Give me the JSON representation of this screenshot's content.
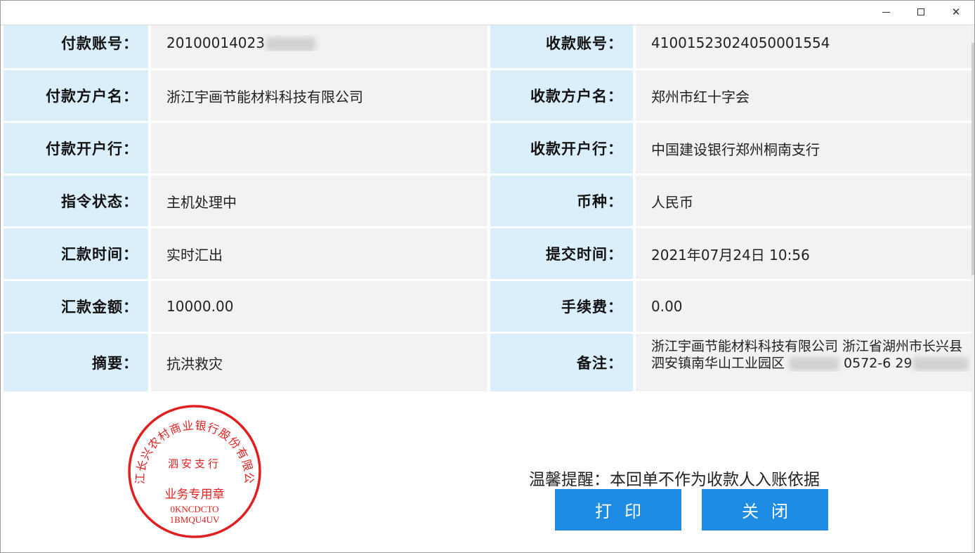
{
  "window": {
    "controls": {
      "minimize": "minimize-icon",
      "maximize": "maximize-icon",
      "close": "close-icon"
    }
  },
  "fields": {
    "payer_account_label": "付款账号：",
    "payer_account_value": "20100014023",
    "payee_account_label": "收款账号：",
    "payee_account_value": "41001523024050001554",
    "payer_name_label": "付款方户名：",
    "payer_name_value": "浙江宇画节能材料科技有限公司",
    "payee_name_label": "收款方户名：",
    "payee_name_value": "郑州市红十字会",
    "payer_bank_label": "付款开户行：",
    "payer_bank_value": "",
    "payee_bank_label": "收款开户行：",
    "payee_bank_value": "中国建设银行郑州桐南支行",
    "status_label": "指令状态：",
    "status_value": "主机处理中",
    "currency_label": "币种：",
    "currency_value": "人民币",
    "remit_time_label": "汇款时间：",
    "remit_time_value": "实时汇出",
    "submit_time_label": "提交时间：",
    "submit_time_value": "2021年07月24日 10:56",
    "amount_label": "汇款金额：",
    "amount_value": "10000.00",
    "fee_label": "手续费：",
    "fee_value": "0.00",
    "summary_label": "摘要：",
    "summary_value": "抗洪救灾",
    "remark_label": "备注：",
    "remark_value_1": "浙江宇画节能材料科技有限公司 浙江省湖州市长兴县泗安镇南华山工业园区",
    "remark_value_2": "0572-6",
    "remark_value_3": "29"
  },
  "seal": {
    "ring_text": "浙江长兴农村商业银行股份有限公司",
    "branch": "泗安支行",
    "purpose": "业务专用章",
    "code_1": "0KNCDCTO",
    "code_2": "1BMQU4UV",
    "color": "#e02020"
  },
  "footer": {
    "notice": "温馨提醒：本回单不作为收款人入账依据",
    "print_label": "打印",
    "close_label": "关闭"
  },
  "colors": {
    "label_bg": "#dbeffb",
    "value_bg": "#f2f2f2",
    "button_bg": "#1e8ce4"
  }
}
